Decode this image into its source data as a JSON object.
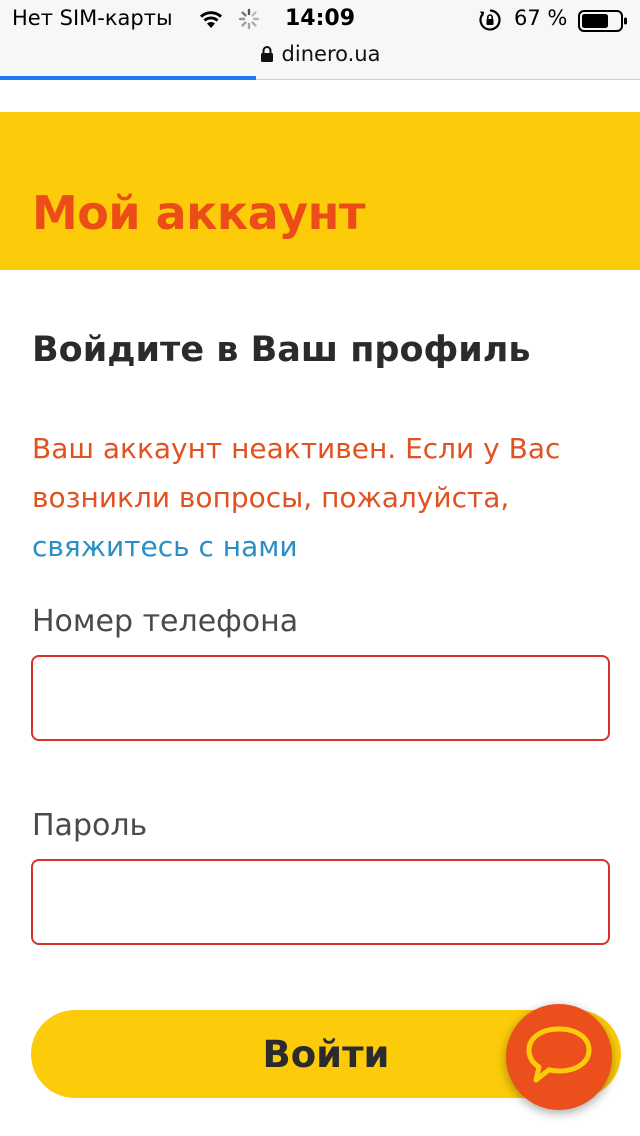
{
  "status_bar": {
    "carrier": "Нет SIM-карты",
    "time": "14:09",
    "battery_percent": "67 %",
    "icons": [
      "wifi-icon",
      "loading-spinner-icon",
      "orientation-lock-icon",
      "battery-icon"
    ]
  },
  "browser": {
    "url": "dinero.ua",
    "load_progress": 0.4
  },
  "header": {
    "title": "Мой аккаунт"
  },
  "login": {
    "subtitle": "Войдите в Ваш профиль",
    "notice_text": "Ваш аккаунт неактивен. Если у Вас возникли вопросы, пожалуйста, ",
    "contact_link": "свяжитесь с нами",
    "phone_label": "Номер телефона",
    "phone_value": "",
    "password_label": "Пароль",
    "password_value": "",
    "submit_label": "Войти"
  },
  "chat": {
    "icon": "chat-bubble-icon"
  },
  "colors": {
    "brand_yellow": "#fccb0a",
    "brand_orange": "#ec4d18",
    "error_red": "#d8302a",
    "link_blue": "#2a8fc4"
  }
}
